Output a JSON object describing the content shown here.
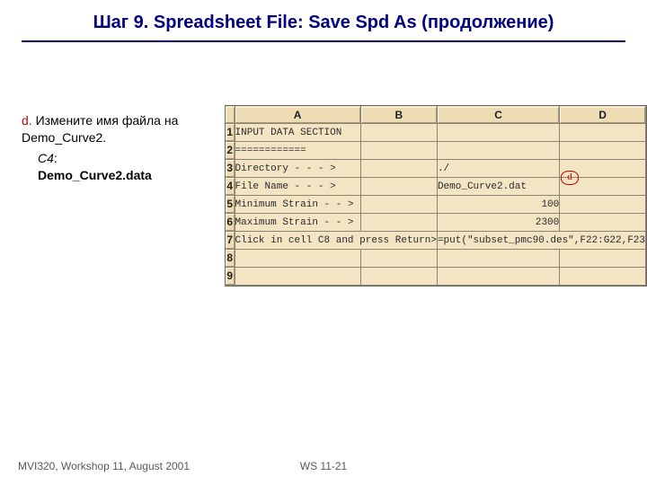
{
  "title": "Шаг 9.  Spreadsheet File:  Save Spd As (продолжение)",
  "instruction": {
    "marker": "d.",
    "line1": "Измените имя файла на Demo_Curve2.",
    "cellref": "C4",
    "cellval": "Demo_Curve2.data"
  },
  "spreadsheet": {
    "columns": [
      "A",
      "B",
      "C",
      "D"
    ],
    "rows": [
      "1",
      "2",
      "3",
      "4",
      "5",
      "6",
      "7",
      "8",
      "9"
    ],
    "cells": {
      "r1": {
        "A": "INPUT DATA SECTION",
        "B": "",
        "C": "",
        "D": ""
      },
      "r2": {
        "A": "============",
        "B": "",
        "C": "",
        "D": ""
      },
      "r3": {
        "A": "Directory - - - >",
        "B": "",
        "C": "./",
        "D": ""
      },
      "r4": {
        "A": "File Name - - - >",
        "B": "",
        "C": "Demo_Curve2.dat",
        "D": ""
      },
      "r5": {
        "A": "Minimum Strain - - >",
        "B": "",
        "C": "100",
        "D": ""
      },
      "r6": {
        "A": "Maximum Strain - - >",
        "B": "",
        "C": "2300",
        "D": ""
      },
      "r7": {
        "A": "Click in cell C8 and press Return>",
        "B": "",
        "C": "=put(\"subset_pmc90.des\",F22:G22,F23",
        "D": ""
      },
      "r8": {
        "A": "",
        "B": "",
        "C": "",
        "D": ""
      },
      "r9": {
        "A": "",
        "B": "",
        "C": "",
        "D": ""
      }
    }
  },
  "annotation_d": "d",
  "footer": {
    "left": "MVI320, Workshop 11, August 2001",
    "center": "WS 11-21"
  }
}
